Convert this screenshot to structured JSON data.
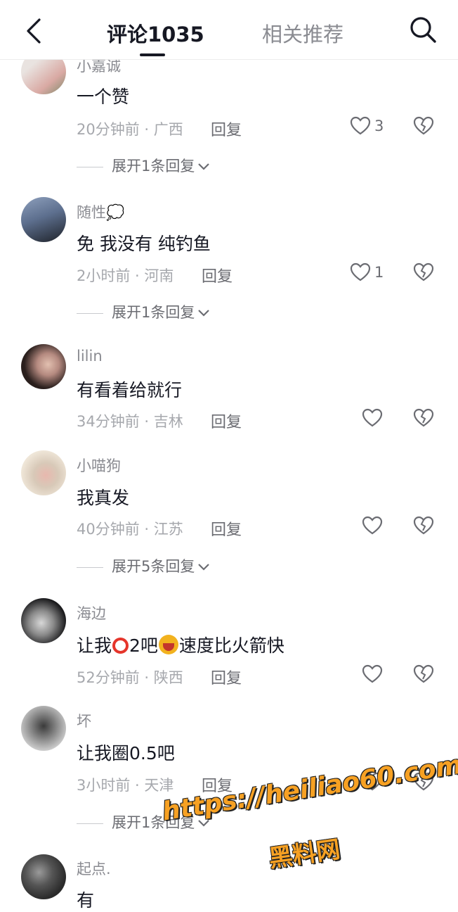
{
  "header": {
    "active_tab": "评论1035",
    "other_tab": "相关推荐",
    "back_icon": "chevron-left-icon",
    "search_icon": "search-icon"
  },
  "reply_label": "回复",
  "comments": [
    {
      "name": "小嘉诚",
      "text": "一个赞",
      "meta": "20分钟前 · 广西",
      "likes": "3",
      "expand": "展开1条回复",
      "avatar_colors": [
        "#e9e3e0",
        "#d9a9a3"
      ]
    },
    {
      "name": "随性💭",
      "text": "免 我没有 纯钓鱼",
      "meta": "2小时前 · 河南",
      "likes": "1",
      "expand": "展开1条回复",
      "avatar_colors": [
        "#5d6f8e",
        "#1e2229"
      ]
    },
    {
      "name": "lilin",
      "text": "有看着给就行",
      "meta": "34分钟前 · 吉林",
      "likes": "",
      "expand": "",
      "avatar_colors": [
        "#2a1f1d",
        "#e2c0b0"
      ]
    },
    {
      "name": "小喵狗",
      "text": "我真发",
      "meta": "40分钟前 · 江苏",
      "likes": "",
      "expand": "展开5条回复",
      "avatar_colors": [
        "#efe6d8",
        "#e8b8ae"
      ]
    },
    {
      "name": "海边",
      "text_parts": [
        "让我",
        "2吧",
        "速度比火箭快"
      ],
      "meta": "52分钟前 · 陕西",
      "likes": "",
      "expand": "",
      "avatar_colors": [
        "#1c1c1e",
        "#d8d8d8"
      ]
    },
    {
      "name": "坏",
      "text": "让我圈0.5吧",
      "meta": "3小时前 · 天津",
      "likes": "",
      "expand": "展开1条回复",
      "avatar_colors": [
        "#bcbcbc",
        "#3a3a3a"
      ]
    },
    {
      "name": "起点.",
      "text": "有",
      "meta": "",
      "likes": "",
      "expand": "",
      "avatar_colors": [
        "#2b2b2b",
        "#9a9a9a"
      ]
    }
  ],
  "watermark": {
    "url": "https://heiliao60.com",
    "name": "黑料网"
  }
}
